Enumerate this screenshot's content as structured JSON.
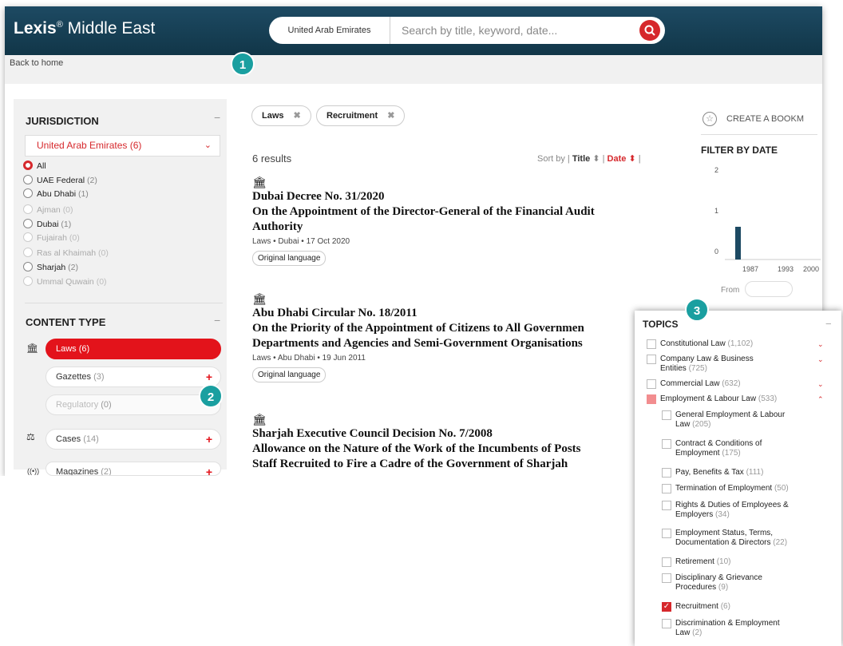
{
  "header": {
    "logo_bold": "Lexis",
    "logo_reg": "®",
    "logo_rest": " Middle East",
    "search_scope": "United Arab Emirates",
    "search_placeholder": "Search by title, keyword, date..."
  },
  "breadcrumb": "Back to home",
  "jurisdiction": {
    "heading": "JURISDICTION",
    "selected": "United Arab Emirates (6)",
    "options": [
      {
        "label": "All",
        "count": ""
      },
      {
        "label": "UAE Federal",
        "count": "(2)"
      },
      {
        "label": "Abu Dhabi",
        "count": "(1)"
      },
      {
        "label": "Ajman",
        "count": "(0)"
      },
      {
        "label": "Dubai",
        "count": "(1)"
      },
      {
        "label": "Fujairah",
        "count": "(0)"
      },
      {
        "label": "Ras al Khaimah",
        "count": "(0)"
      },
      {
        "label": "Sharjah",
        "count": "(2)"
      },
      {
        "label": "Ummal Quwain",
        "count": "(0)"
      }
    ]
  },
  "content_type": {
    "heading": "CONTENT TYPE",
    "items": [
      {
        "label": "Laws",
        "count": "(6)"
      },
      {
        "label": "Gazettes",
        "count": "(3)"
      },
      {
        "label": "Regulatory",
        "count": "(0)"
      },
      {
        "label": "Cases",
        "count": "(14)"
      },
      {
        "label": "Magazines",
        "count": "(2)"
      }
    ]
  },
  "filters": {
    "chips": [
      "Laws",
      "Recruitment"
    ],
    "results_count": "6 results",
    "sort_by": "Sort by",
    "sort_title": "Title",
    "sort_date": "Date"
  },
  "results": [
    {
      "lines": [
        "Dubai Decree No. 31/2020",
        "On the Appointment of the Director-General of the Financial Audit",
        "Authority"
      ],
      "meta": "Laws • Dubai • 17 Oct 2020",
      "badge": "Original language"
    },
    {
      "lines": [
        "Abu Dhabi Circular No. 18/2011",
        "On the Priority of the Appointment of Citizens to All Governmen",
        "Departments and Agencies and Semi-Government Organisations"
      ],
      "meta": "Laws • Abu Dhabi • 19 Jun 2011",
      "badge": "Original language"
    },
    {
      "lines": [
        "Sharjah Executive Council Decision No. 7/2008",
        "Allowance on the Nature of the Work of the Incumbents of Posts",
        "Staff Recruited to Fire a Cadre of the Government of Sharjah"
      ]
    }
  ],
  "right": {
    "bookmark": "CREATE A BOOKM",
    "filter_heading": "FILTER BY DATE",
    "from_label": "From"
  },
  "chart_data": {
    "type": "bar",
    "x_ticks": [
      "1987",
      "1993",
      "2000"
    ],
    "y_ticks": [
      "0",
      "1",
      "2"
    ],
    "ylim": [
      0,
      2
    ],
    "bars": [
      {
        "x": "1987",
        "value": 1
      }
    ]
  },
  "markers": [
    "1",
    "2",
    "3"
  ],
  "topics": {
    "heading": "TOPICS",
    "items": [
      {
        "label": "Constitutional Law",
        "count": "(1,102)",
        "state": "none",
        "chev": "⌄",
        "level": 0
      },
      {
        "label": "Company Law & Business",
        "label2": "Entities",
        "count": "(725)",
        "state": "none",
        "chev": "⌄",
        "level": 0
      },
      {
        "label": "Commercial Law",
        "count": "(632)",
        "state": "none",
        "chev": "⌄",
        "level": 0
      },
      {
        "label": "Employment & Labour Law",
        "count": "(533)",
        "state": "part",
        "chev": "⌃",
        "level": 0
      },
      {
        "label": "General Employment & Labour",
        "label2": "Law",
        "count": "(205)",
        "state": "none",
        "level": 1
      },
      {
        "label": "Contract & Conditions of",
        "label2": "Employment",
        "count": "(175)",
        "state": "none",
        "level": 1
      },
      {
        "label": "Pay, Benefits & Tax",
        "count": "(111)",
        "state": "none",
        "level": 1
      },
      {
        "label": "Termination of Employment",
        "count": "(50)",
        "state": "none",
        "level": 1
      },
      {
        "label": "Rights & Duties of Employees &",
        "label2": "Employers",
        "count": "(34)",
        "state": "none",
        "level": 1
      },
      {
        "label": "Employment Status, Terms,",
        "label2": "Documentation & Directors",
        "count": "(22)",
        "state": "none",
        "level": 1
      },
      {
        "label": "Retirement",
        "count": "(10)",
        "state": "none",
        "level": 1
      },
      {
        "label": "Disciplinary & Grievance",
        "label2": "Procedures",
        "count": "(9)",
        "state": "none",
        "level": 1
      },
      {
        "label": "Recruitment",
        "count": "(6)",
        "state": "checked",
        "level": 1
      },
      {
        "label": "Discrimination & Employment",
        "label2": "Law",
        "count": "(2)",
        "state": "none",
        "level": 1
      }
    ]
  }
}
